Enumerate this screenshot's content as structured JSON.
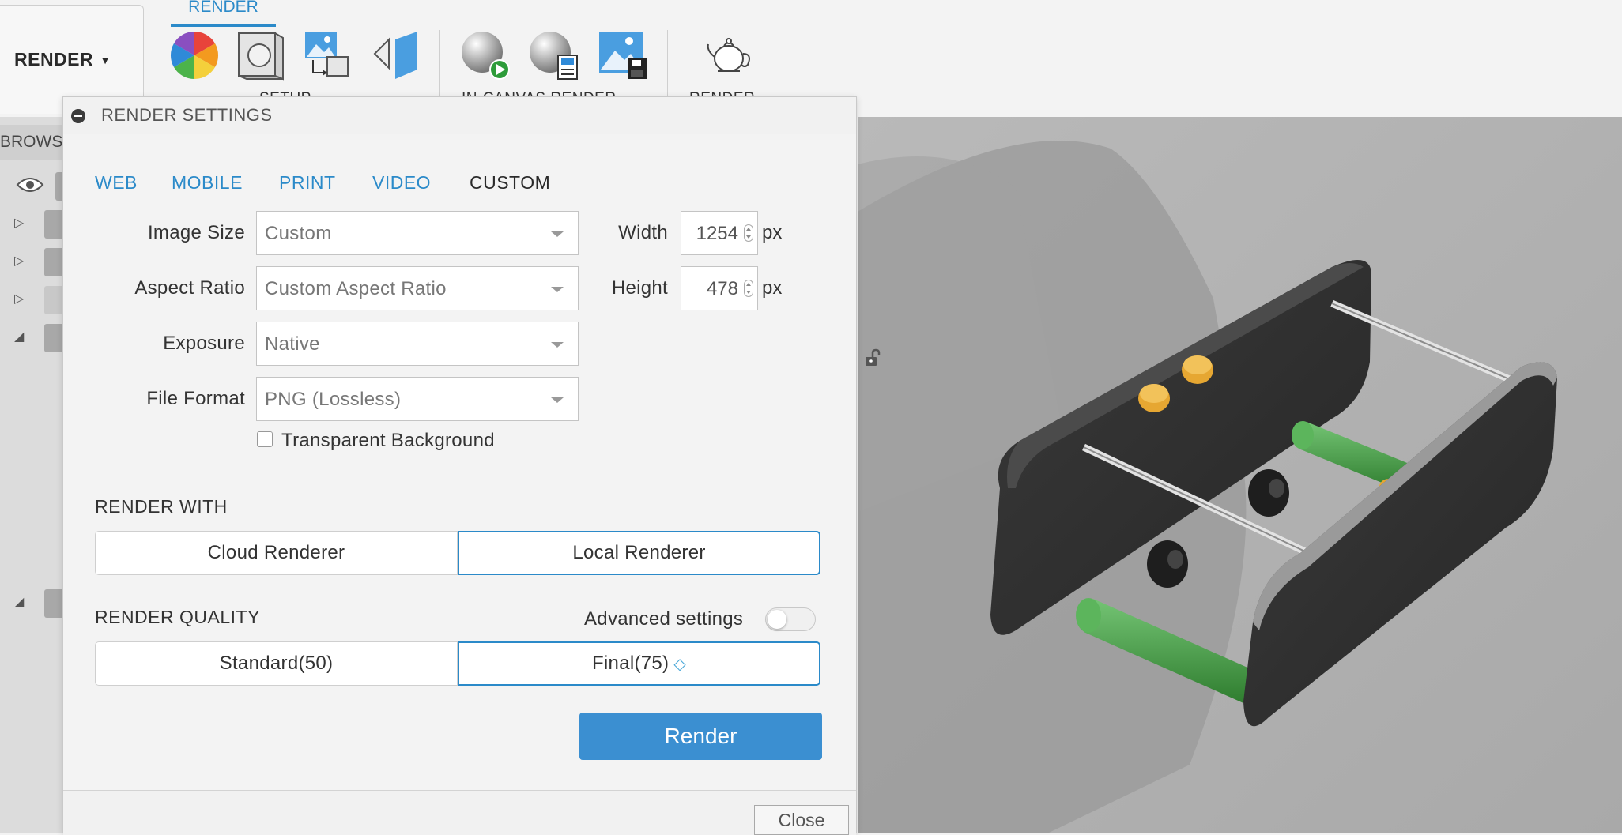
{
  "toolbar": {
    "workspace_label": "RENDER",
    "active_tab": "RENDER",
    "groups": [
      {
        "label": "SETUP"
      },
      {
        "label": "IN-CANVAS RENDER"
      },
      {
        "label": "RENDER"
      }
    ],
    "icons": [
      "appearance-icon",
      "scene-settings-icon",
      "texture-map-icon",
      "decal-icon",
      "in-canvas-render-icon",
      "in-canvas-settings-icon",
      "capture-image-icon",
      "render-teapot-icon"
    ]
  },
  "browser": {
    "header": "BROWSER"
  },
  "dialog": {
    "title": "RENDER SETTINGS",
    "presets": [
      "WEB",
      "MOBILE",
      "PRINT",
      "VIDEO",
      "CUSTOM"
    ],
    "active_preset": "CUSTOM",
    "image_size": {
      "label": "Image Size",
      "value": "Custom"
    },
    "aspect_ratio": {
      "label": "Aspect Ratio",
      "value": "Custom Aspect Ratio"
    },
    "exposure": {
      "label": "Exposure",
      "value": "Native"
    },
    "file_format": {
      "label": "File Format",
      "value": "PNG (Lossless)"
    },
    "width": {
      "label": "Width",
      "value": "1254",
      "unit": "px"
    },
    "height": {
      "label": "Height",
      "value": "478",
      "unit": "px"
    },
    "transparent_background": {
      "label": "Transparent Background",
      "checked": false
    },
    "render_with": {
      "title": "RENDER WITH",
      "options": [
        "Cloud Renderer",
        "Local Renderer"
      ],
      "selected": "Local Renderer"
    },
    "render_quality": {
      "title": "RENDER QUALITY",
      "advanced_label": "Advanced settings",
      "advanced_on": false,
      "options": [
        "Standard(50)",
        "Final(75)"
      ],
      "selected": "Final(75)"
    },
    "render_button": "Render",
    "close_button": "Close"
  },
  "colors": {
    "accent": "#2b8ac9",
    "render_button": "#3b8fd1",
    "viewport_bg": "#b5b5b5",
    "plate": "#333333",
    "rod_green": "#3f9a3f",
    "standoff_orange": "#e0a030"
  }
}
